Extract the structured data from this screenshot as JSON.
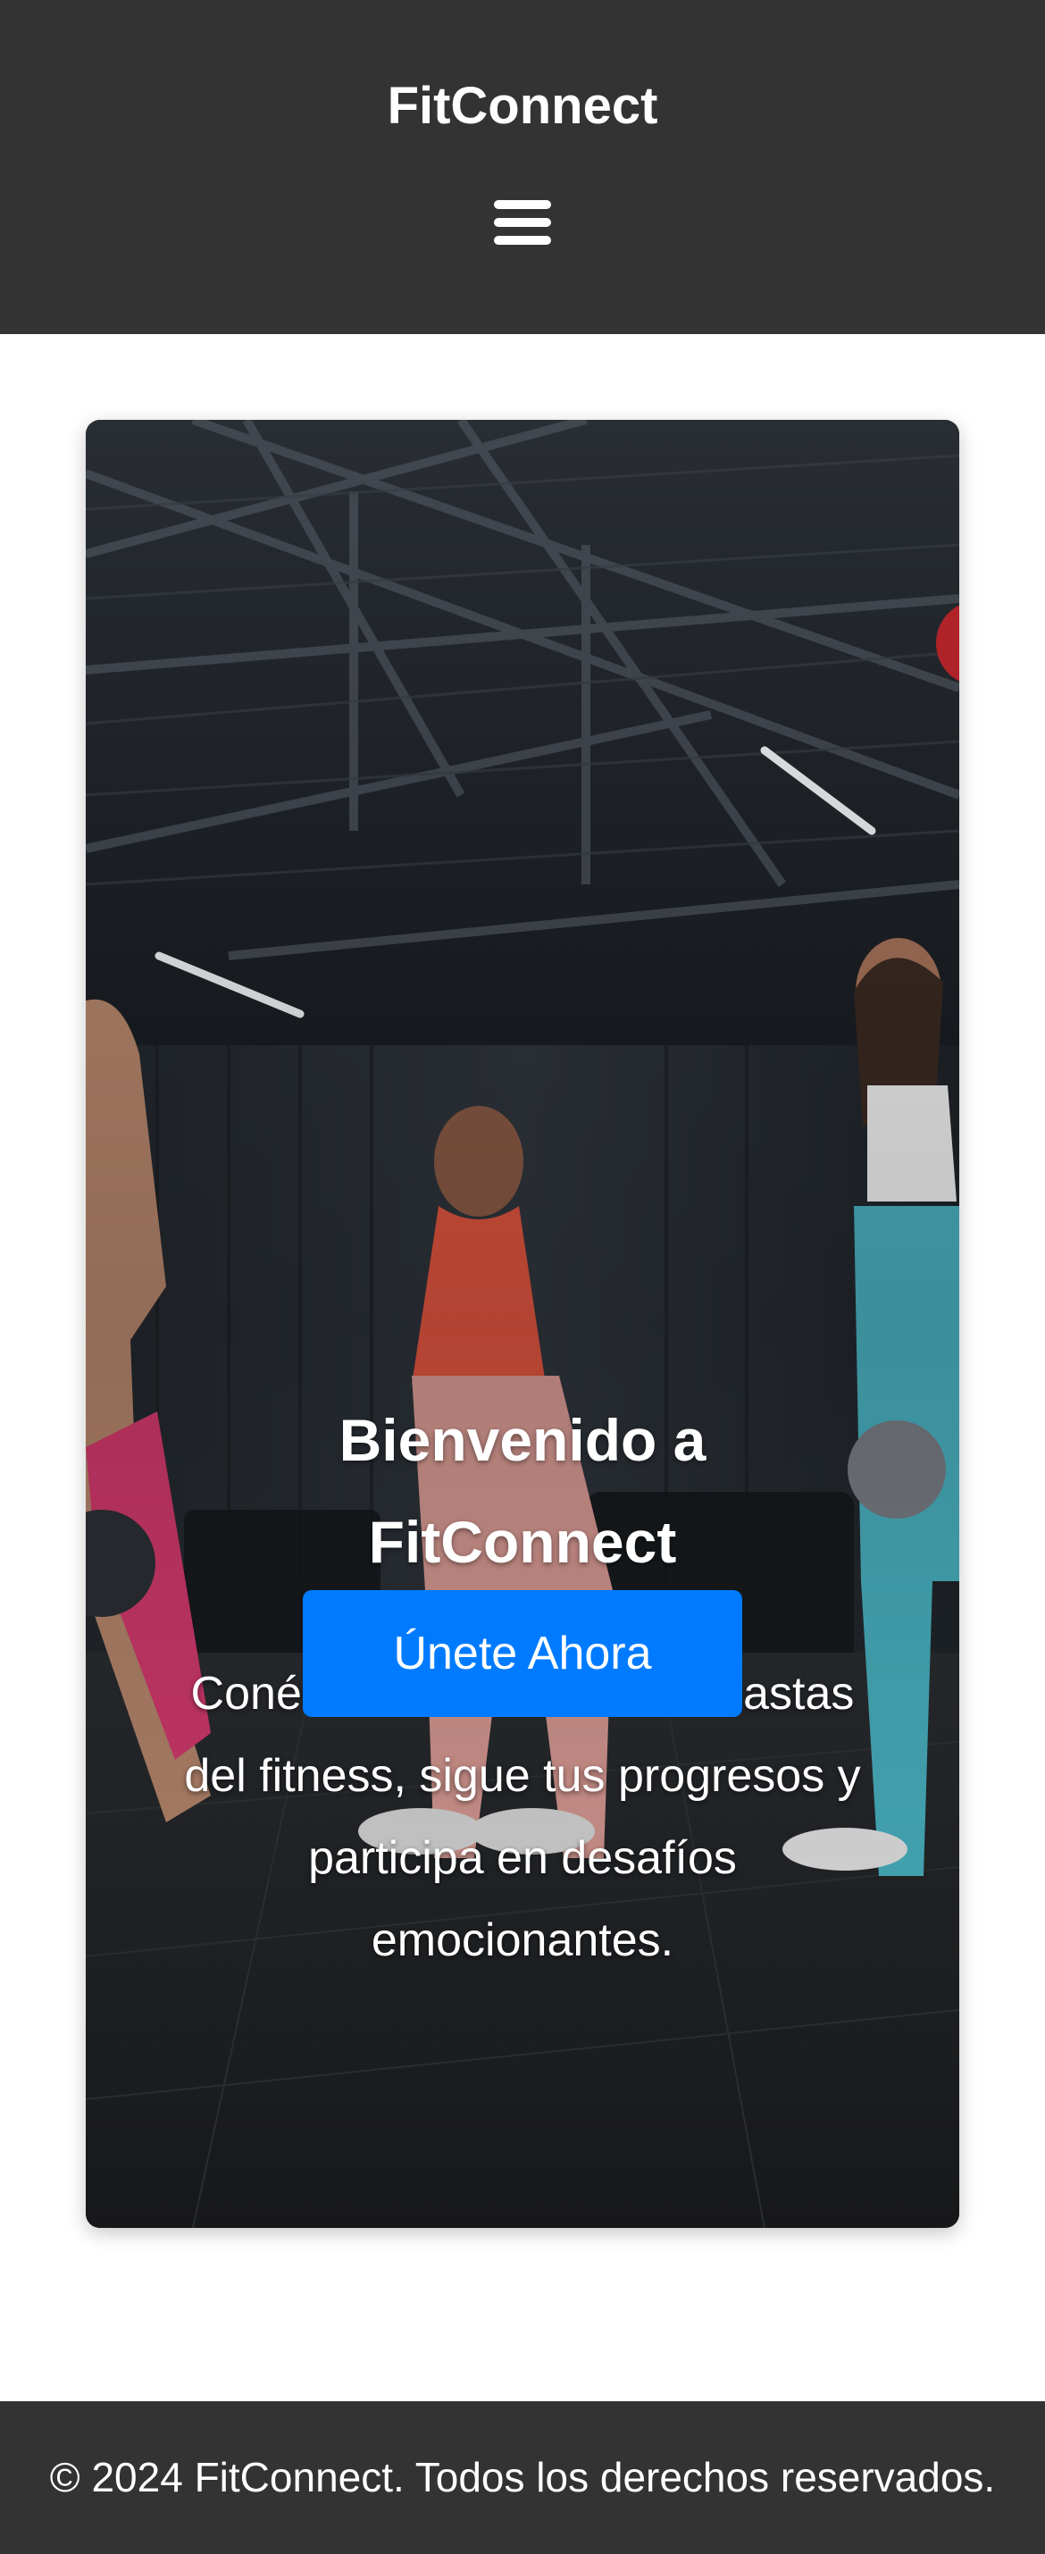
{
  "header": {
    "brand": "FitConnect",
    "menu_icon": "hamburger-menu-icon"
  },
  "hero": {
    "title": "Bienvenido a FitConnect",
    "text": "Conéctate con otros entusiastas del fitness, sigue tus progresos y participa en desafíos emocionantes.",
    "cta_label": "Únete Ahora",
    "background_image": "gym-kettlebell-class-photo"
  },
  "footer": {
    "text": "© 2024 FitConnect. Todos los derechos reservados."
  },
  "colors": {
    "header_bg": "#333333",
    "footer_bg": "#333333",
    "accent": "#007bff",
    "text_light": "#ffffff"
  }
}
